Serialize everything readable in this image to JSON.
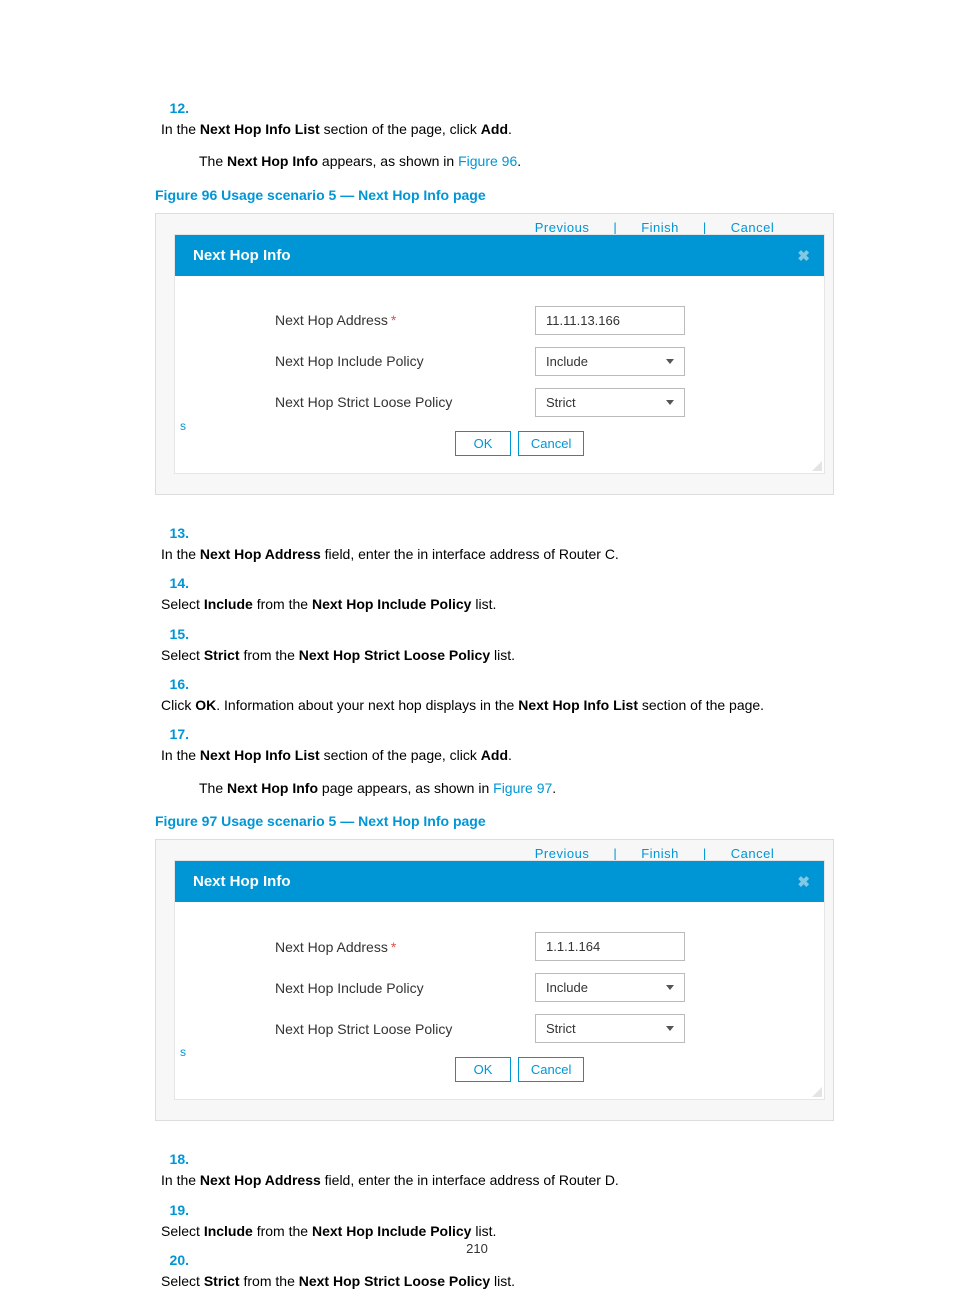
{
  "steps": {
    "s12_num": "12.",
    "s12_pre": "In the ",
    "s12_b1": "Next Hop Info List",
    "s12_mid": " section of the page, click ",
    "s12_b2": "Add",
    "s12_post": ".",
    "s12_sub_pre": "The ",
    "s12_sub_b": "Next Hop Info",
    "s12_sub_mid": " appears, as shown in ",
    "s12_sub_link": "Figure 96",
    "s12_sub_post": ".",
    "s13_num": "13.",
    "s13_pre": "In the ",
    "s13_b1": "Next Hop Address",
    "s13_post": " field, enter the in interface address of Router C.",
    "s14_num": "14.",
    "s14_pre": "Select ",
    "s14_b1": "Include",
    "s14_mid": " from the ",
    "s14_b2": "Next Hop Include Policy",
    "s14_post": " list.",
    "s15_num": "15.",
    "s15_pre": "Select ",
    "s15_b1": "Strict",
    "s15_mid": " from the ",
    "s15_b2": "Next Hop Strict Loose Policy",
    "s15_post": " list.",
    "s16_num": "16.",
    "s16_pre": "Click ",
    "s16_b1": "OK",
    "s16_mid": ". Information about your next hop displays in the ",
    "s16_b2": "Next Hop Info List",
    "s16_post": " section of the page.",
    "s17_num": "17.",
    "s17_pre": "In the ",
    "s17_b1": "Next Hop Info List",
    "s17_mid": " section of the page, click ",
    "s17_b2": "Add",
    "s17_post": ".",
    "s17_sub_pre": "The ",
    "s17_sub_b": "Next Hop Info",
    "s17_sub_mid": " page appears, as shown in ",
    "s17_sub_link": "Figure 97",
    "s17_sub_post": ".",
    "s18_num": "18.",
    "s18_pre": "In the ",
    "s18_b1": "Next Hop Address",
    "s18_post": " field, enter the in interface address of Router D.",
    "s19_num": "19.",
    "s19_pre": "Select ",
    "s19_b1": "Include",
    "s19_mid": " from the ",
    "s19_b2": "Next Hop Include Policy",
    "s19_post": " list.",
    "s20_num": "20.",
    "s20_pre": "Select ",
    "s20_b1": "Strict",
    "s20_mid": " from the ",
    "s20_b2": "Next Hop Strict Loose Policy",
    "s20_post": " list."
  },
  "fig96": {
    "caption": "Figure 96 Usage scenario 5 — Next Hop Info page",
    "wizard_prev": "Previous",
    "wizard_finish": "Finish",
    "wizard_cancel": "Cancel",
    "title": "Next Hop Info",
    "label_addr": "Next Hop Address",
    "req": "*",
    "val_addr": "11.11.13.166",
    "label_include": "Next Hop Include Policy",
    "val_include": "Include",
    "label_strict": "Next Hop Strict Loose Policy",
    "val_strict": "Strict",
    "btn_ok": "OK",
    "btn_cancel": "Cancel",
    "left_label": "s"
  },
  "fig97": {
    "caption": "Figure 97 Usage scenario 5 — Next Hop Info page",
    "wizard_prev": "Previous",
    "wizard_finish": "Finish",
    "wizard_cancel": "Cancel",
    "title": "Next Hop Info",
    "label_addr": "Next Hop Address",
    "req": "*",
    "val_addr": "1.1.1.164",
    "label_include": "Next Hop Include Policy",
    "val_include": "Include",
    "label_strict": "Next Hop Strict Loose Policy",
    "val_strict": "Strict",
    "btn_ok": "OK",
    "btn_cancel": "Cancel",
    "left_label": "s"
  },
  "page_number": "210"
}
